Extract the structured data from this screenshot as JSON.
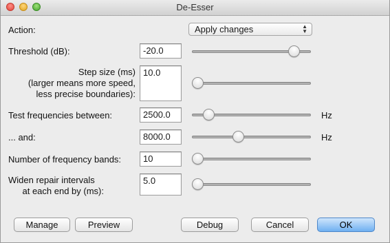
{
  "window": {
    "title": "De-Esser"
  },
  "action": {
    "label": "Action:",
    "selected": "Apply changes"
  },
  "params": [
    {
      "label": "Threshold (dB):",
      "value": "-20.0",
      "slider_fraction": 0.9
    },
    {
      "label": "Step size (ms)\n(larger means more speed,\nless precise boundaries):",
      "value": "10.0",
      "slider_fraction": 0.0
    },
    {
      "label": "Test frequencies between:",
      "value": "2500.0",
      "unit": "Hz",
      "slider_fraction": 0.1
    },
    {
      "label": "... and:",
      "value": "8000.0",
      "unit": "Hz",
      "slider_fraction": 0.38
    },
    {
      "label": "Number of frequency bands:",
      "value": "10",
      "slider_fraction": 0.0
    },
    {
      "label": "Widen repair intervals\nat each end by (ms):",
      "value": "5.0",
      "slider_fraction": 0.0
    }
  ],
  "buttons": {
    "manage": "Manage",
    "preview": "Preview",
    "debug": "Debug",
    "cancel": "Cancel",
    "ok": "OK"
  },
  "colors": {
    "default_button": "#6fb0f1"
  }
}
